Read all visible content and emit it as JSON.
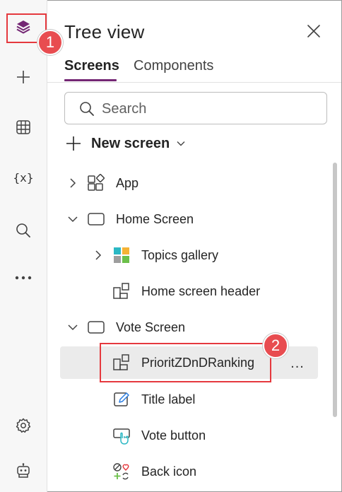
{
  "header": {
    "title": "Tree view"
  },
  "tabs": [
    {
      "label": "Screens",
      "active": true
    },
    {
      "label": "Components",
      "active": false
    }
  ],
  "search": {
    "placeholder": "Search"
  },
  "new_screen": {
    "label": "New screen"
  },
  "tree": [
    {
      "label": "App",
      "icon": "app-icon",
      "expander": "collapsed"
    },
    {
      "label": "Home Screen",
      "icon": "screen-icon",
      "expander": "expanded"
    },
    {
      "label": "Topics gallery",
      "icon": "gallery-icon",
      "expander": "collapsed"
    },
    {
      "label": "Home screen header",
      "icon": "container-icon",
      "expander": "none"
    },
    {
      "label": "Vote Screen",
      "icon": "screen-icon",
      "expander": "expanded"
    },
    {
      "label": "PrioritZDnDRanking",
      "icon": "container-icon",
      "expander": "none",
      "selected": true
    },
    {
      "label": "Title label",
      "icon": "label-icon",
      "expander": "none"
    },
    {
      "label": "Vote button",
      "icon": "button-icon",
      "expander": "none"
    },
    {
      "label": "Back icon",
      "icon": "icon-control-icon",
      "expander": "none"
    }
  ],
  "rail": [
    "layers-icon",
    "plus-icon",
    "table-icon",
    "variables-icon",
    "search-icon",
    "more-icon",
    "settings-icon",
    "copilot-icon"
  ],
  "rail_variables_text": "{x}",
  "more_actions_label": "...",
  "callouts": [
    {
      "number": "1"
    },
    {
      "number": "2"
    }
  ],
  "colors": {
    "accent": "#742774",
    "callout": "#e84c50",
    "selected_row": "#ebebeb"
  }
}
